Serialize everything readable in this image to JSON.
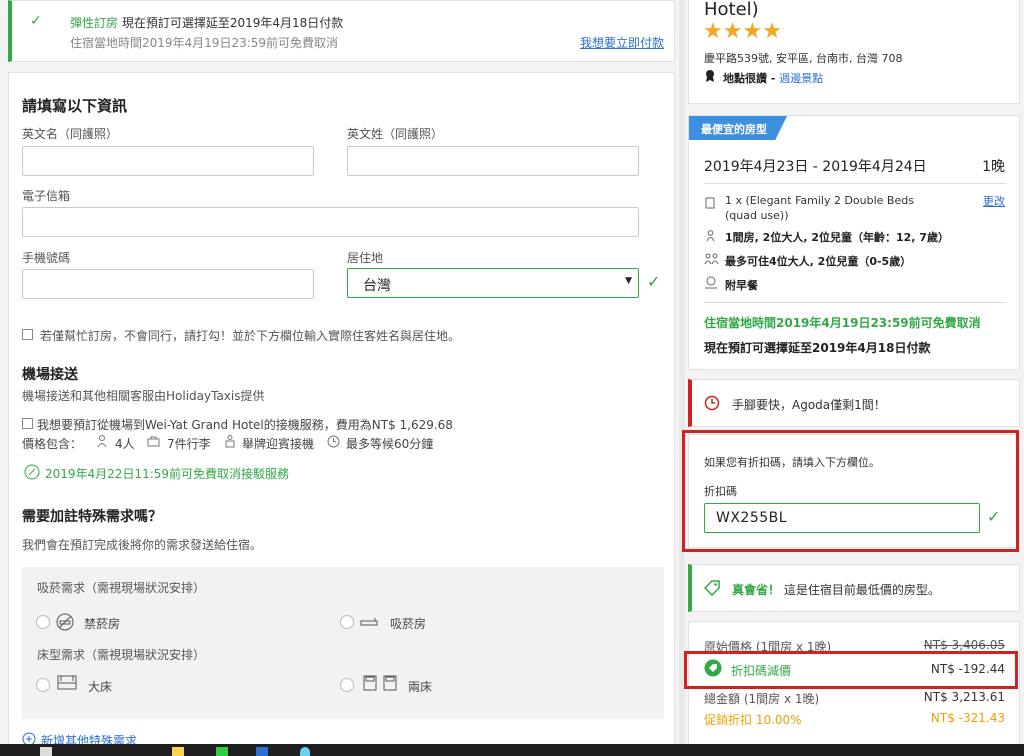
{
  "notice": {
    "title_green": "彈性訂房",
    "title_rest": "現在預訂可選擇延至2019年4月18日付款",
    "subtitle": "住宿當地時間2019年4月19日23:59前可免費取消",
    "pay_now_link": "我想要立即付款"
  },
  "form": {
    "heading": "請填寫以下資訊",
    "first_name_label": "英文名（同護照）",
    "last_name_label": "英文姓（同護照）",
    "email_label": "電子信箱",
    "phone_label": "手機號碼",
    "residence_label": "居住地",
    "residence_value": "台灣",
    "booking_for_other": "若僅幫忙訂房，不會同行，請打勾！並於下方欄位輸入實際住客姓名與居住地。"
  },
  "airport": {
    "heading": "機場接送",
    "provider": "機場接送和其他相關客服由HolidayTaxis提供",
    "option_label": "我想要預訂從機場到Wei-Yat Grand Hotel的接機服務，費用為NT$ 1,629.68",
    "includes_label": "價格包含：",
    "persons": "4人",
    "luggage": "7件行李",
    "sign": "舉牌迎賓接機",
    "wait": "最多等候60分鐘",
    "free_cancel": "2019年4月22日11:59前可免費取消接駁服務"
  },
  "special": {
    "heading": "需要加註特殊需求嗎？",
    "subtitle": "我們會在預訂完成後將你的需求發送給住宿。",
    "smoking_label": "吸菸需求（需視現場狀況安排）",
    "non_smoking": "禁菸房",
    "smoking": "吸菸房",
    "bed_label": "床型需求（需視現場狀況安排）",
    "large_bed": "大床",
    "twin_bed": "兩床",
    "add_more": "新增其他特殊需求"
  },
  "hotel": {
    "name_tail": "Hotel)",
    "rating_stars": 4,
    "address": "慶平路539號, 安平區, 台南市, 台灣 708",
    "location_label": "地點很讚 - ",
    "nearby_link": "週邊景點"
  },
  "room": {
    "badge": "最便宜的房型",
    "dates": "2019年4月23日 - 2019年4月24日",
    "nights": "1晚",
    "room_type": "1 x (Elegant Family 2 Double Beds (quad use))",
    "change_link": "更改",
    "occupancy": "1間房, 2位大人, 2位兒童",
    "ages": "（年齡：12, 7歲）",
    "max_occupancy": "最多可住4位大人, 2位兒童",
    "max_ages": "（0-5歲）",
    "breakfast": "附早餐",
    "free_cancel": "住宿當地時間2019年4月19日23:59前可免費取消",
    "pay_later": "現在預訂可選擇延至2019年4月18日付款"
  },
  "urgency": {
    "text": "手腳要快，Agoda僅剩1間！"
  },
  "promo": {
    "prompt": "如果您有折扣碼，請填入下方欄位。",
    "code_label": "折扣碼",
    "code_value": "WX255BL"
  },
  "deal": {
    "highlight": "真會省！",
    "text": "這是住宿目前最低價的房型。"
  },
  "price": {
    "original_label": "原始價格 (1間房 x 1晚)",
    "original_value": "NT$ 3,406.05",
    "discount_label": "折扣碼減價",
    "discount_value": "NT$ -192.44",
    "total_label": "總金額 (1間房 x 1晚)",
    "total_value": "NT$ 3,213.61",
    "promo_label": "促銷折扣 10.00%",
    "promo_value": "NT$ -321.43"
  },
  "colors": {
    "accent_green": "#32a945",
    "link_blue": "#2a6fd6",
    "badge_blue": "#3d8fe0",
    "annotation_red": "#d32020",
    "promo_orange": "#f0a000"
  }
}
